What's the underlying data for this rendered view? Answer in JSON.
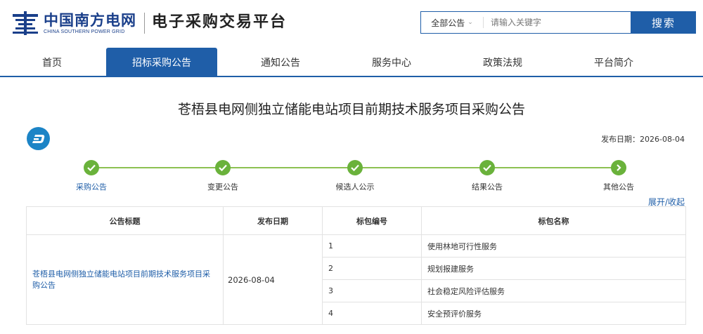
{
  "header": {
    "logo_cn": "中国南方电网",
    "logo_en": "CHINA SOUTHERN POWER GRID",
    "platform_title": "电子采购交易平台",
    "search_scope": "全部公告",
    "search_placeholder": "请输入关键字",
    "search_button": "搜索"
  },
  "nav": {
    "items": [
      {
        "label": "首页"
      },
      {
        "label": "招标采购公告"
      },
      {
        "label": "通知公告"
      },
      {
        "label": "服务中心"
      },
      {
        "label": "政策法规"
      },
      {
        "label": "平台简介"
      }
    ],
    "active_index": 1
  },
  "notice": {
    "title": "苍梧县电网侧独立储能电站项目前期技术服务项目采购公告",
    "publish_date_label": "发布日期：",
    "publish_date": "2026-08-04",
    "publish_date_text": "发布日期：2026-08-04"
  },
  "stepper": {
    "steps": [
      {
        "label": "采购公告",
        "status": "done"
      },
      {
        "label": "变更公告",
        "status": "done"
      },
      {
        "label": "候选人公示",
        "status": "done"
      },
      {
        "label": "结果公告",
        "status": "done"
      },
      {
        "label": "其他公告",
        "status": "next"
      }
    ],
    "current_index": 0
  },
  "toggle_label": "展开/收起",
  "table": {
    "headers": [
      "公告标题",
      "发布日期",
      "标包编号",
      "标包名称"
    ],
    "notice_title": "苍梧县电网侧独立储能电站项目前期技术服务项目采购公告",
    "publish_date": "2026-08-04",
    "packages": [
      {
        "no": "1",
        "name": "使用林地可行性服务"
      },
      {
        "no": "2",
        "name": "规划报建服务"
      },
      {
        "no": "3",
        "name": "社会稳定风险评估服务"
      },
      {
        "no": "4",
        "name": "安全预评价服务"
      }
    ]
  },
  "colors": {
    "primary": "#1f5ea8",
    "step_green": "#6ab23b",
    "icon_blue": "#1c84c6"
  }
}
